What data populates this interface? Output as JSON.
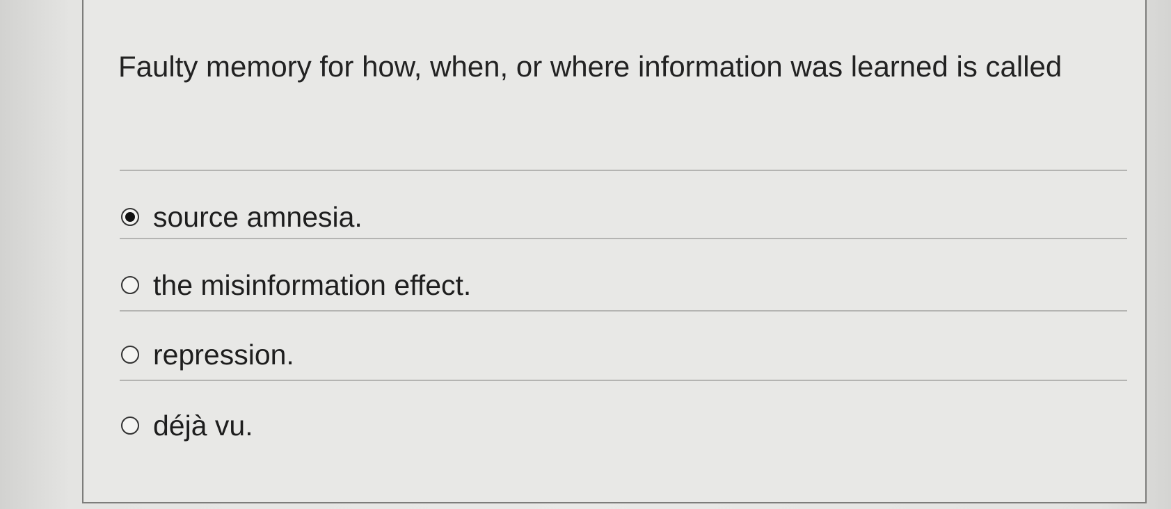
{
  "question": {
    "text": "Faulty memory for how, when, or where information was learned is called"
  },
  "options": [
    {
      "label": "source amnesia.",
      "selected": true
    },
    {
      "label": "the misinformation effect.",
      "selected": false
    },
    {
      "label": "repression.",
      "selected": false
    },
    {
      "label": "déjà vu.",
      "selected": false
    }
  ]
}
